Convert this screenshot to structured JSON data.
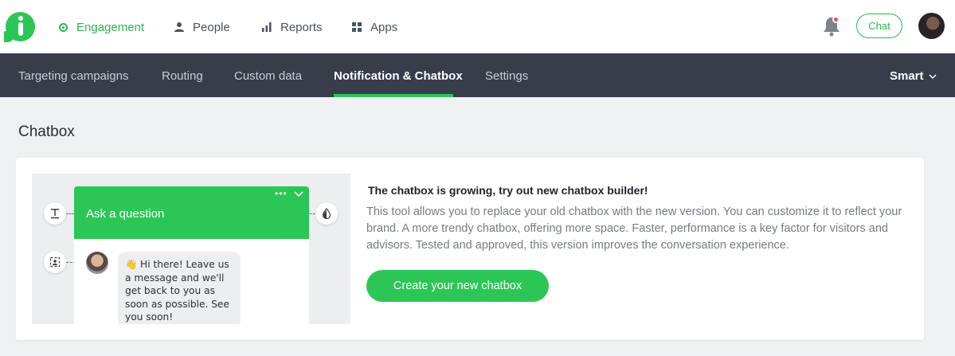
{
  "nav": {
    "items": [
      {
        "label": "Engagement",
        "icon": "engagement-icon",
        "active": true
      },
      {
        "label": "People",
        "icon": "person-icon",
        "active": false
      },
      {
        "label": "Reports",
        "icon": "bar-chart-icon",
        "active": false
      },
      {
        "label": "Apps",
        "icon": "grid-icon",
        "active": false
      }
    ],
    "chat_label": "Chat"
  },
  "subnav": {
    "tabs": [
      {
        "label": "Targeting campaigns",
        "active": false
      },
      {
        "label": "Routing",
        "active": false
      },
      {
        "label": "Custom data",
        "active": false
      },
      {
        "label": "Notification & Chatbox",
        "active": true
      },
      {
        "label": "Settings",
        "active": false
      }
    ],
    "mode_label": "Smart"
  },
  "page": {
    "title": "Chatbox"
  },
  "preview": {
    "header": "Ask a question",
    "message": "👋 Hi there! Leave us a message and we'll get back to you as soon as possible. See you soon!"
  },
  "promo": {
    "headline": "The chatbox is growing, try out new chatbox builder!",
    "description": "This tool allows you to replace your old chatbox with the new version. You can customize it to reflect your brand. A more trendy chatbox, offering more space. Faster, performance is a key factor for visitors and advisors. Tested and approved, this version improves the conversation experience.",
    "cta_label": "Create your new chatbox"
  },
  "colors": {
    "brand_green": "#2cc656",
    "subnav_bg": "#373d49",
    "page_bg": "#eef0f2"
  }
}
